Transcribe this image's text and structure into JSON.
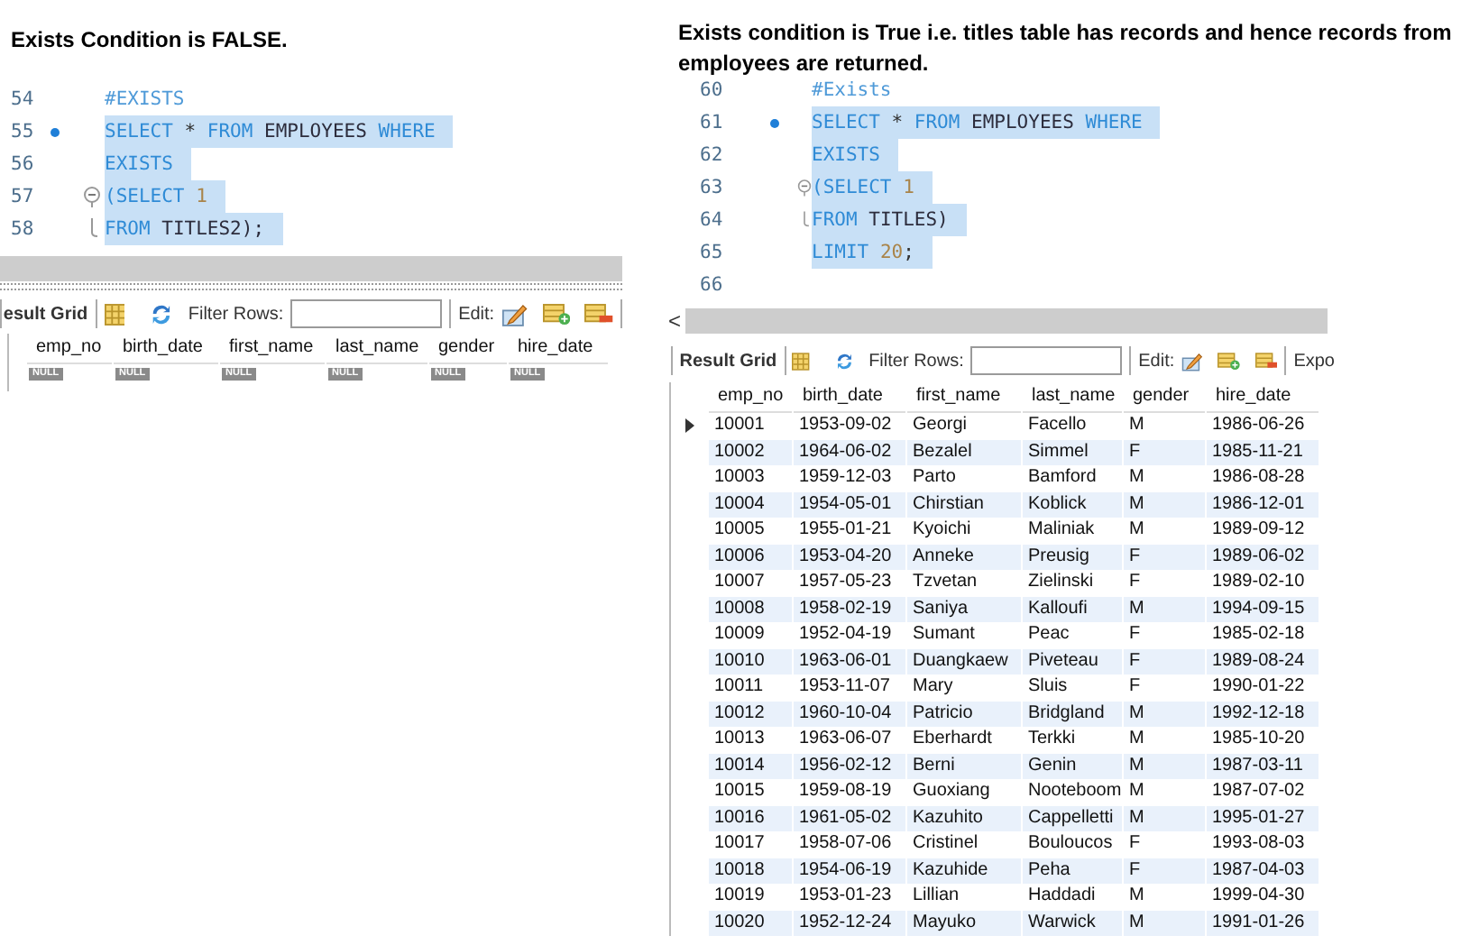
{
  "panels": [
    {
      "heading": "Exists Condition is FALSE.",
      "code": {
        "lines": [
          {
            "number": "54",
            "marker": false,
            "kind": "plain",
            "highlighted": false,
            "tokens": [
              {
                "kind": "comment",
                "text": "#EXISTS"
              }
            ]
          },
          {
            "number": "55",
            "marker": true,
            "kind": "plain",
            "highlighted": true,
            "tokens": [
              {
                "kind": "keyword",
                "text": "SELECT"
              },
              {
                "kind": "punct",
                "text": " * "
              },
              {
                "kind": "keyword",
                "text": "FROM"
              },
              {
                "kind": "ident",
                "text": " EMPLOYEES "
              },
              {
                "kind": "keyword",
                "text": "WHERE"
              }
            ]
          },
          {
            "number": "56",
            "marker": false,
            "kind": "plain",
            "highlighted": true,
            "tokens": [
              {
                "kind": "keyword",
                "text": "EXISTS"
              }
            ]
          },
          {
            "number": "57",
            "marker": false,
            "kind": "fold-start",
            "highlighted": true,
            "tokens": [
              {
                "kind": "keyword",
                "text": "(SELECT "
              },
              {
                "kind": "number",
                "text": "1"
              }
            ]
          },
          {
            "number": "58",
            "marker": false,
            "kind": "fold-end",
            "highlighted": true,
            "tokens": [
              {
                "kind": "keyword",
                "text": "FROM"
              },
              {
                "kind": "ident",
                "text": " TITLES2);"
              }
            ]
          }
        ]
      },
      "toolbar": {
        "result_grid_label": "esult Grid",
        "filter_label": "Filter Rows:",
        "edit_label": "Edit:"
      },
      "grid": {
        "columns": [
          "emp_no",
          "birth_date",
          "first_name",
          "last_name",
          "gender",
          "hire_date"
        ],
        "rows": [
          {
            "current": false,
            "cells": [
              {
                "kind": "null",
                "text": "NULL"
              },
              {
                "kind": "null",
                "text": "NULL"
              },
              {
                "kind": "null",
                "text": "NULL"
              },
              {
                "kind": "null",
                "text": "NULL"
              },
              {
                "kind": "null",
                "text": "NULL"
              },
              {
                "kind": "null",
                "text": "NULL"
              }
            ]
          }
        ]
      }
    },
    {
      "heading": "Exists condition is True i.e. titles table has records and hence records from employees are returned.",
      "code": {
        "lines": [
          {
            "number": "60",
            "marker": false,
            "kind": "plain",
            "highlighted": false,
            "tokens": [
              {
                "kind": "comment",
                "text": "#Exists"
              }
            ]
          },
          {
            "number": "61",
            "marker": true,
            "kind": "plain",
            "highlighted": true,
            "tokens": [
              {
                "kind": "keyword",
                "text": "SELECT"
              },
              {
                "kind": "punct",
                "text": " * "
              },
              {
                "kind": "keyword",
                "text": "FROM"
              },
              {
                "kind": "ident",
                "text": " EMPLOYEES "
              },
              {
                "kind": "keyword",
                "text": "WHERE"
              }
            ]
          },
          {
            "number": "62",
            "marker": false,
            "kind": "plain",
            "highlighted": true,
            "tokens": [
              {
                "kind": "keyword",
                "text": "EXISTS"
              }
            ]
          },
          {
            "number": "63",
            "marker": false,
            "kind": "fold-start",
            "highlighted": true,
            "tokens": [
              {
                "kind": "keyword",
                "text": "(SELECT "
              },
              {
                "kind": "number",
                "text": "1"
              }
            ]
          },
          {
            "number": "64",
            "marker": false,
            "kind": "fold-end",
            "highlighted": true,
            "tokens": [
              {
                "kind": "keyword",
                "text": "FROM"
              },
              {
                "kind": "ident",
                "text": " TITLES)"
              }
            ]
          },
          {
            "number": "65",
            "marker": false,
            "kind": "plain",
            "highlighted": true,
            "tokens": [
              {
                "kind": "keyword",
                "text": "LIMIT "
              },
              {
                "kind": "number",
                "text": "20"
              },
              {
                "kind": "punct",
                "text": ";"
              }
            ]
          },
          {
            "number": "66",
            "marker": false,
            "kind": "plain"
          }
        ]
      },
      "scrollbar": {
        "arrow": "<"
      },
      "toolbar": {
        "result_grid_label": "Result Grid",
        "filter_label": "Filter Rows:",
        "edit_label": "Edit:",
        "export_label": "Expo"
      },
      "grid": {
        "columns": [
          "emp_no",
          "birth_date",
          "first_name",
          "last_name",
          "gender",
          "hire_date"
        ],
        "rows": [
          {
            "current": true,
            "cells": [
              {
                "text": "10001"
              },
              {
                "text": "1953-09-02"
              },
              {
                "text": "Georgi"
              },
              {
                "text": "Facello"
              },
              {
                "text": "M"
              },
              {
                "text": "1986-06-26"
              }
            ]
          },
          {
            "current": false,
            "cells": [
              {
                "text": "10002"
              },
              {
                "text": "1964-06-02"
              },
              {
                "text": "Bezalel"
              },
              {
                "text": "Simmel"
              },
              {
                "text": "F"
              },
              {
                "text": "1985-11-21"
              }
            ]
          },
          {
            "current": false,
            "cells": [
              {
                "text": "10003"
              },
              {
                "text": "1959-12-03"
              },
              {
                "text": "Parto"
              },
              {
                "text": "Bamford"
              },
              {
                "text": "M"
              },
              {
                "text": "1986-08-28"
              }
            ]
          },
          {
            "current": false,
            "cells": [
              {
                "text": "10004"
              },
              {
                "text": "1954-05-01"
              },
              {
                "text": "Chirstian"
              },
              {
                "text": "Koblick"
              },
              {
                "text": "M"
              },
              {
                "text": "1986-12-01"
              }
            ]
          },
          {
            "current": false,
            "cells": [
              {
                "text": "10005"
              },
              {
                "text": "1955-01-21"
              },
              {
                "text": "Kyoichi"
              },
              {
                "text": "Maliniak"
              },
              {
                "text": "M"
              },
              {
                "text": "1989-09-12"
              }
            ]
          },
          {
            "current": false,
            "cells": [
              {
                "text": "10006"
              },
              {
                "text": "1953-04-20"
              },
              {
                "text": "Anneke"
              },
              {
                "text": "Preusig"
              },
              {
                "text": "F"
              },
              {
                "text": "1989-06-02"
              }
            ]
          },
          {
            "current": false,
            "cells": [
              {
                "text": "10007"
              },
              {
                "text": "1957-05-23"
              },
              {
                "text": "Tzvetan"
              },
              {
                "text": "Zielinski"
              },
              {
                "text": "F"
              },
              {
                "text": "1989-02-10"
              }
            ]
          },
          {
            "current": false,
            "cells": [
              {
                "text": "10008"
              },
              {
                "text": "1958-02-19"
              },
              {
                "text": "Saniya"
              },
              {
                "text": "Kalloufi"
              },
              {
                "text": "M"
              },
              {
                "text": "1994-09-15"
              }
            ]
          },
          {
            "current": false,
            "cells": [
              {
                "text": "10009"
              },
              {
                "text": "1952-04-19"
              },
              {
                "text": "Sumant"
              },
              {
                "text": "Peac"
              },
              {
                "text": "F"
              },
              {
                "text": "1985-02-18"
              }
            ]
          },
          {
            "current": false,
            "cells": [
              {
                "text": "10010"
              },
              {
                "text": "1963-06-01"
              },
              {
                "text": "Duangkaew"
              },
              {
                "text": "Piveteau"
              },
              {
                "text": "F"
              },
              {
                "text": "1989-08-24"
              }
            ]
          },
          {
            "current": false,
            "cells": [
              {
                "text": "10011"
              },
              {
                "text": "1953-11-07"
              },
              {
                "text": "Mary"
              },
              {
                "text": "Sluis"
              },
              {
                "text": "F"
              },
              {
                "text": "1990-01-22"
              }
            ]
          },
          {
            "current": false,
            "cells": [
              {
                "text": "10012"
              },
              {
                "text": "1960-10-04"
              },
              {
                "text": "Patricio"
              },
              {
                "text": "Bridgland"
              },
              {
                "text": "M"
              },
              {
                "text": "1992-12-18"
              }
            ]
          },
          {
            "current": false,
            "cells": [
              {
                "text": "10013"
              },
              {
                "text": "1963-06-07"
              },
              {
                "text": "Eberhardt"
              },
              {
                "text": "Terkki"
              },
              {
                "text": "M"
              },
              {
                "text": "1985-10-20"
              }
            ]
          },
          {
            "current": false,
            "cells": [
              {
                "text": "10014"
              },
              {
                "text": "1956-02-12"
              },
              {
                "text": "Berni"
              },
              {
                "text": "Genin"
              },
              {
                "text": "M"
              },
              {
                "text": "1987-03-11"
              }
            ]
          },
          {
            "current": false,
            "cells": [
              {
                "text": "10015"
              },
              {
                "text": "1959-08-19"
              },
              {
                "text": "Guoxiang"
              },
              {
                "text": "Nooteboom"
              },
              {
                "text": "M"
              },
              {
                "text": "1987-07-02"
              }
            ]
          },
          {
            "current": false,
            "cells": [
              {
                "text": "10016"
              },
              {
                "text": "1961-05-02"
              },
              {
                "text": "Kazuhito"
              },
              {
                "text": "Cappelletti"
              },
              {
                "text": "M"
              },
              {
                "text": "1995-01-27"
              }
            ]
          },
          {
            "current": false,
            "cells": [
              {
                "text": "10017"
              },
              {
                "text": "1958-07-06"
              },
              {
                "text": "Cristinel"
              },
              {
                "text": "Bouloucos"
              },
              {
                "text": "F"
              },
              {
                "text": "1993-08-03"
              }
            ]
          },
          {
            "current": false,
            "cells": [
              {
                "text": "10018"
              },
              {
                "text": "1954-06-19"
              },
              {
                "text": "Kazuhide"
              },
              {
                "text": "Peha"
              },
              {
                "text": "F"
              },
              {
                "text": "1987-04-03"
              }
            ]
          },
          {
            "current": false,
            "cells": [
              {
                "text": "10019"
              },
              {
                "text": "1953-01-23"
              },
              {
                "text": "Lillian"
              },
              {
                "text": "Haddadi"
              },
              {
                "text": "M"
              },
              {
                "text": "1999-04-30"
              }
            ]
          },
          {
            "current": false,
            "cells": [
              {
                "text": "10020"
              },
              {
                "text": "1952-12-24"
              },
              {
                "text": "Mayuko"
              },
              {
                "text": "Warwick"
              },
              {
                "text": "M"
              },
              {
                "text": "1991-01-26"
              }
            ]
          }
        ]
      }
    }
  ]
}
